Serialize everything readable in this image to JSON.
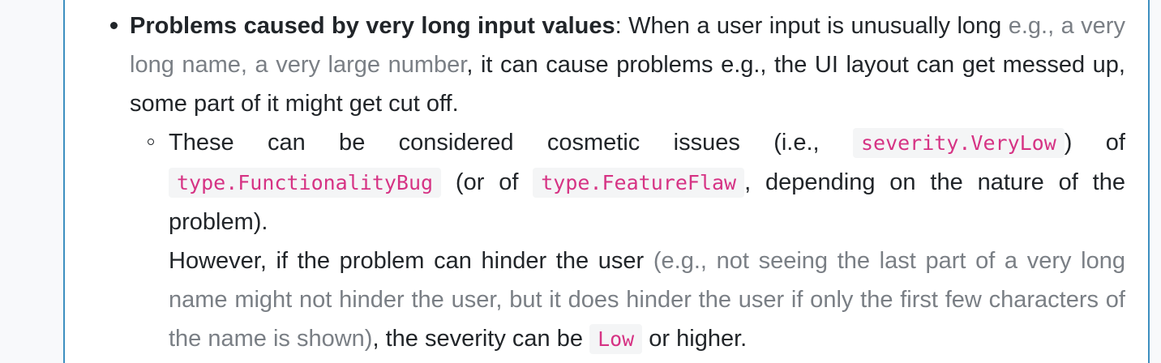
{
  "item": {
    "title": "Problems caused by very long input values",
    "sep": ":",
    "text_a": " When a user input is unusually long ",
    "examples": "e.g., a very long name, a very large number",
    "text_b": ", it can cause problems e.g., the UI layout can get messed up, some part of it might get cut off."
  },
  "subitem": {
    "text_a": "These can be considered cosmetic issues (i.e., ",
    "code_severity": "severity.VeryLow",
    "text_b": ") of ",
    "code_type1": "type.FunctionalityBug",
    "text_c": " (or of ",
    "code_type2": "type.FeatureFlaw",
    "text_d": ", depending on the nature of the problem).",
    "para2_a": "However, if the problem can hinder the user ",
    "para2_note": "(e.g., not seeing the last part of a very long name might not hinder the user, but it does hinder the user if only the first few characters of the name is shown)",
    "para2_b": ", the severity can be ",
    "code_low": "Low",
    "para2_c": " or higher."
  }
}
